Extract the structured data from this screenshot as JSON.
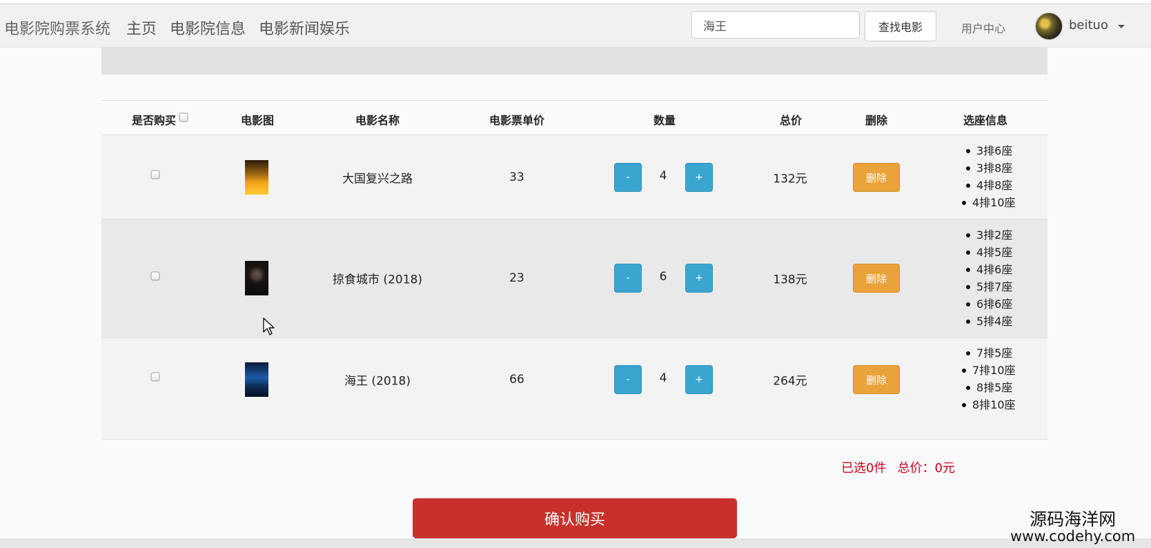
{
  "navbar": {
    "brand": "电影院购票系统",
    "links": [
      "主页",
      "电影院信息",
      "电影新闻娱乐"
    ],
    "search_value": "海王",
    "search_button": "查找电影",
    "user_center": "用户中心",
    "username": "beituo"
  },
  "table": {
    "headers": {
      "buy": "是否购买",
      "poster": "电影图",
      "name": "电影名称",
      "price": "电影票单价",
      "quantity": "数量",
      "total": "总价",
      "delete": "删除",
      "seats": "选座信息"
    },
    "rows": [
      {
        "name": "大国复兴之路",
        "price": "33",
        "quantity": "4",
        "total": "132元",
        "seats": [
          "3排6座",
          "3排8座",
          "4排8座",
          "4排10座"
        ]
      },
      {
        "name": "掠食城市 (2018)",
        "price": "23",
        "quantity": "6",
        "total": "138元",
        "seats": [
          "3排2座",
          "4排5座",
          "4排6座",
          "5排7座",
          "6排6座",
          "5排4座"
        ]
      },
      {
        "name": "海王 (2018)",
        "price": "66",
        "quantity": "4",
        "total": "264元",
        "seats": [
          "7排5座",
          "7排10座",
          "8排5座",
          "8排10座"
        ]
      }
    ],
    "minus_label": "-",
    "plus_label": "+",
    "delete_label": "删除"
  },
  "summary": {
    "selected": "已选0件",
    "total": "总价：0元"
  },
  "confirm_button": "确认购买",
  "watermark": {
    "line1": "源码海洋网",
    "line2": "www.codehy.com"
  },
  "colors": {
    "info_button": "#3aa6d0",
    "warning_button": "#e9a33a",
    "danger_button": "#c9302c",
    "summary_text": "#d0021b"
  }
}
